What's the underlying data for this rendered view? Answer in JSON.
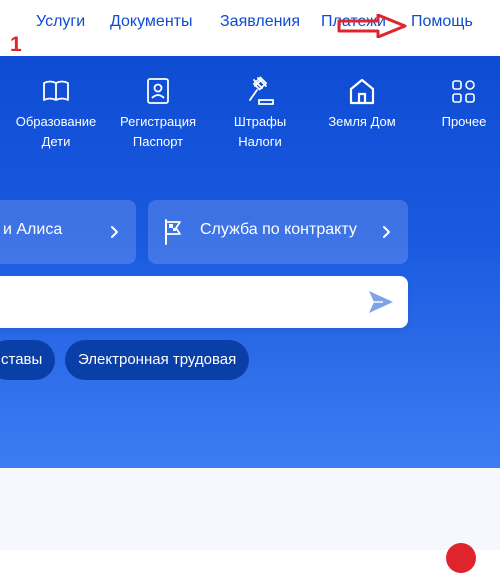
{
  "nav": {
    "items": [
      "Услуги",
      "Документы",
      "Заявления",
      "Платежи",
      "Помощь"
    ]
  },
  "annotation": {
    "number": "1",
    "arrow_color": "#e0242d"
  },
  "categories": [
    {
      "label": "Образование\nДети",
      "icon": "book-icon"
    },
    {
      "label": "Регистрация\nПаспорт",
      "icon": "id-card-icon"
    },
    {
      "label": "Штрафы\nНалоги",
      "icon": "gavel-icon"
    },
    {
      "label": "Земля Дом",
      "icon": "house-icon"
    },
    {
      "label": "Прочее",
      "icon": "grid-icon"
    }
  ],
  "quick_cards": [
    {
      "label": "и Алиса"
    },
    {
      "label": "Служба по контракту",
      "icon": "flag-icon"
    }
  ],
  "search": {
    "placeholder": "",
    "value": ""
  },
  "chips": [
    "ставы",
    "Электронная трудовая"
  ],
  "colors": {
    "brand_blue": "#0d4cd3",
    "chip_blue": "#0b3fa8",
    "accent_red": "#e0242d",
    "send_icon": "#7fa3e6"
  }
}
